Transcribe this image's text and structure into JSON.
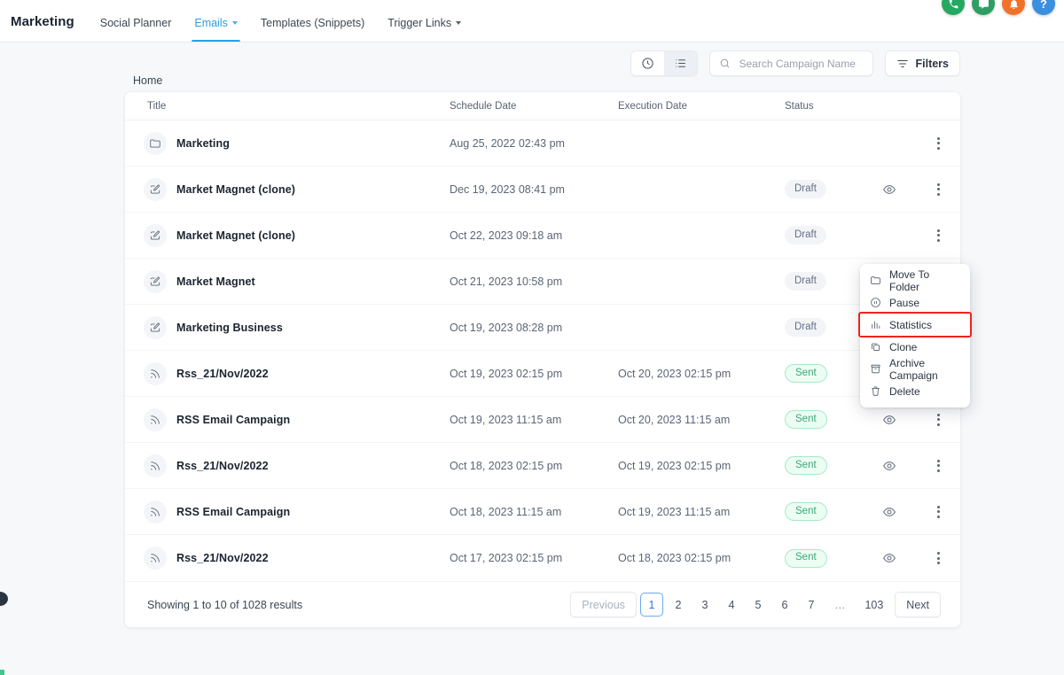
{
  "fabs": [
    {
      "name": "phone-fab",
      "icon": "phone-icon",
      "color": "#27a862"
    },
    {
      "name": "chat-fab",
      "icon": "chat-message-icon",
      "color": "#2f9e63"
    },
    {
      "name": "bell-fab",
      "icon": "bell-icon",
      "color": "#f2712a"
    },
    {
      "name": "help-fab",
      "icon": "question-mark-icon",
      "color": "#3b8fe0",
      "glyph": "?"
    }
  ],
  "topbar": {
    "brand": "Marketing",
    "tabs": [
      {
        "label": "Social Planner",
        "active": false,
        "caret": false
      },
      {
        "label": "Emails",
        "active": true,
        "caret": true
      },
      {
        "label": "Templates (Snippets)",
        "active": false,
        "caret": false
      },
      {
        "label": "Trigger Links",
        "active": false,
        "caret": true
      }
    ]
  },
  "toolbar": {
    "history_view_label": "History view",
    "list_view_label": "List view",
    "search_placeholder": "Search Campaign Name",
    "search_value": "",
    "filters_label": "Filters"
  },
  "breadcrumb": "Home",
  "table": {
    "columns": {
      "title": "Title",
      "schedule_date": "Schedule Date",
      "execution_date": "Execution Date",
      "status": "Status"
    },
    "rows": [
      {
        "icon": "folder-icon",
        "title": "Marketing",
        "schedule": "Aug 25, 2022 02:43 pm",
        "execution": "",
        "status": "",
        "has_eye": false
      },
      {
        "icon": "edit-icon",
        "title": "Market Magnet (clone)",
        "schedule": "Dec 19, 2023 08:41 pm",
        "execution": "",
        "status": "Draft",
        "has_eye": true
      },
      {
        "icon": "edit-icon",
        "title": "Market Magnet (clone)",
        "schedule": "Oct 22, 2023 09:18 am",
        "execution": "",
        "status": "Draft",
        "has_eye": false
      },
      {
        "icon": "edit-icon",
        "title": "Market Magnet",
        "schedule": "Oct 21, 2023 10:58 pm",
        "execution": "",
        "status": "Draft",
        "has_eye": false
      },
      {
        "icon": "edit-icon",
        "title": "Marketing Business",
        "schedule": "Oct 19, 2023 08:28 pm",
        "execution": "",
        "status": "Draft",
        "has_eye": false
      },
      {
        "icon": "rss-icon",
        "title": "Rss_21/Nov/2022",
        "schedule": "Oct 19, 2023 02:15 pm",
        "execution": "Oct 20, 2023 02:15 pm",
        "status": "Sent",
        "has_eye": true
      },
      {
        "icon": "rss-icon",
        "title": "RSS Email Campaign",
        "schedule": "Oct 19, 2023 11:15 am",
        "execution": "Oct 20, 2023 11:15 am",
        "status": "Sent",
        "has_eye": true
      },
      {
        "icon": "rss-icon",
        "title": "Rss_21/Nov/2022",
        "schedule": "Oct 18, 2023 02:15 pm",
        "execution": "Oct 19, 2023 02:15 pm",
        "status": "Sent",
        "has_eye": true
      },
      {
        "icon": "rss-icon",
        "title": "RSS Email Campaign",
        "schedule": "Oct 18, 2023 11:15 am",
        "execution": "Oct 19, 2023 11:15 am",
        "status": "Sent",
        "has_eye": true
      },
      {
        "icon": "rss-icon",
        "title": "Rss_21/Nov/2022",
        "schedule": "Oct 17, 2023 02:15 pm",
        "execution": "Oct 18, 2023 02:15 pm",
        "status": "Sent",
        "has_eye": true
      }
    ]
  },
  "footer": {
    "showing": "Showing 1 to 10 of 1028 results",
    "previous_label": "Previous",
    "next_label": "Next",
    "pages": [
      "1",
      "2",
      "3",
      "4",
      "5",
      "6",
      "7",
      "…",
      "103"
    ],
    "current_page": "1"
  },
  "context_menu": {
    "highlighted_item": "Statistics",
    "highlight_color": "#f0231f",
    "items": [
      {
        "label": "Move To Folder",
        "icon": "folder-icon"
      },
      {
        "label": "Pause",
        "icon": "pause-circle-icon"
      },
      {
        "label": "Statistics",
        "icon": "bar-chart-icon"
      },
      {
        "label": "Clone",
        "icon": "copy-icon"
      },
      {
        "label": "Archive Campaign",
        "icon": "archive-icon"
      },
      {
        "label": "Delete",
        "icon": "trash-icon"
      }
    ]
  }
}
